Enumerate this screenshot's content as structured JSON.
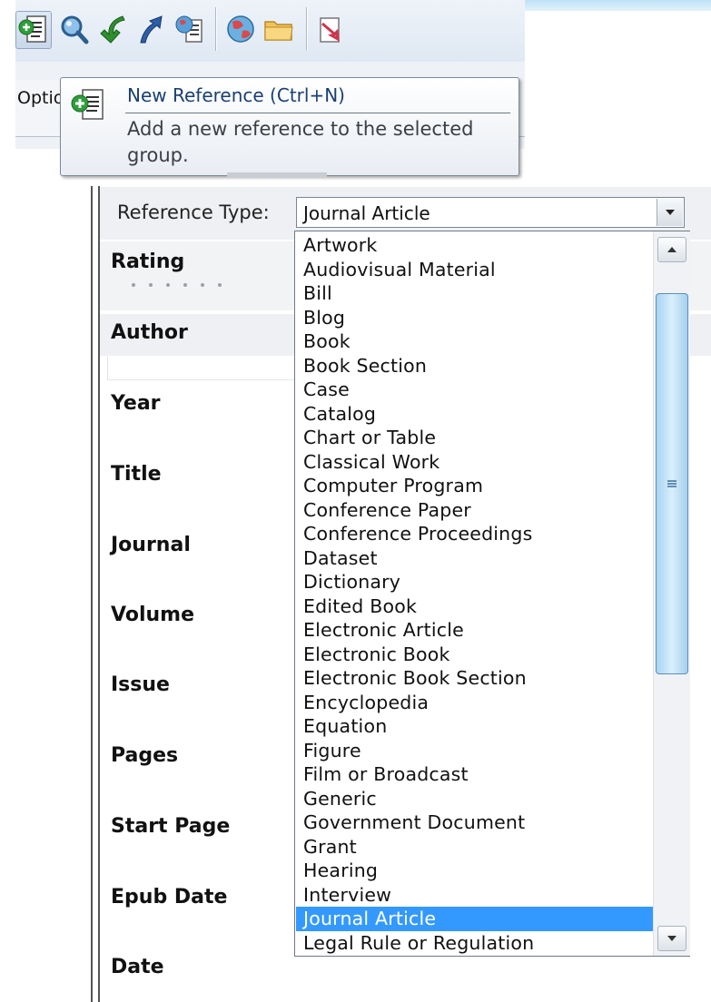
{
  "toolbar": {
    "buttons": [
      {
        "name": "new-reference",
        "icon": "new-document-icon"
      },
      {
        "name": "search",
        "icon": "magnifier-icon"
      },
      {
        "name": "back",
        "icon": "green-back-arrow-icon"
      },
      {
        "name": "forward",
        "icon": "blue-up-arrow-icon"
      },
      {
        "name": "online",
        "icon": "globe-document-icon"
      },
      {
        "name": "web",
        "icon": "globe-icon"
      },
      {
        "name": "folder",
        "icon": "folder-icon"
      },
      {
        "name": "export",
        "icon": "export-arrow-icon"
      }
    ],
    "options_tab_label": "Optio"
  },
  "tooltip": {
    "title": "New Reference (Ctrl+N)",
    "description": "Add a new reference to the selected group."
  },
  "form": {
    "reference_type_label": "Reference Type:",
    "reference_type_value": "Journal Article",
    "fields": [
      "Rating",
      "Author",
      "Year",
      "Title",
      "Journal",
      "Volume",
      "Issue",
      "Pages",
      "Start Page",
      "Epub Date",
      "Date"
    ]
  },
  "dropdown": {
    "items": [
      "Artwork",
      "Audiovisual Material",
      "Bill",
      "Blog",
      "Book",
      "Book Section",
      "Case",
      "Catalog",
      "Chart or Table",
      "Classical Work",
      "Computer Program",
      "Conference Paper",
      "Conference Proceedings",
      "Dataset",
      "Dictionary",
      "Edited Book",
      "Electronic Article",
      "Electronic Book",
      "Electronic Book Section",
      "Encyclopedia",
      "Equation",
      "Figure",
      "Film or Broadcast",
      "Generic",
      "Government Document",
      "Grant",
      "Hearing",
      "Interview",
      "Journal Article",
      "Legal Rule or Regulation"
    ],
    "selected_index": 28
  },
  "colors": {
    "selection": "#3399ff",
    "tooltip_title": "#1b3f72",
    "toolbar_bg": "#e4ecf5"
  }
}
